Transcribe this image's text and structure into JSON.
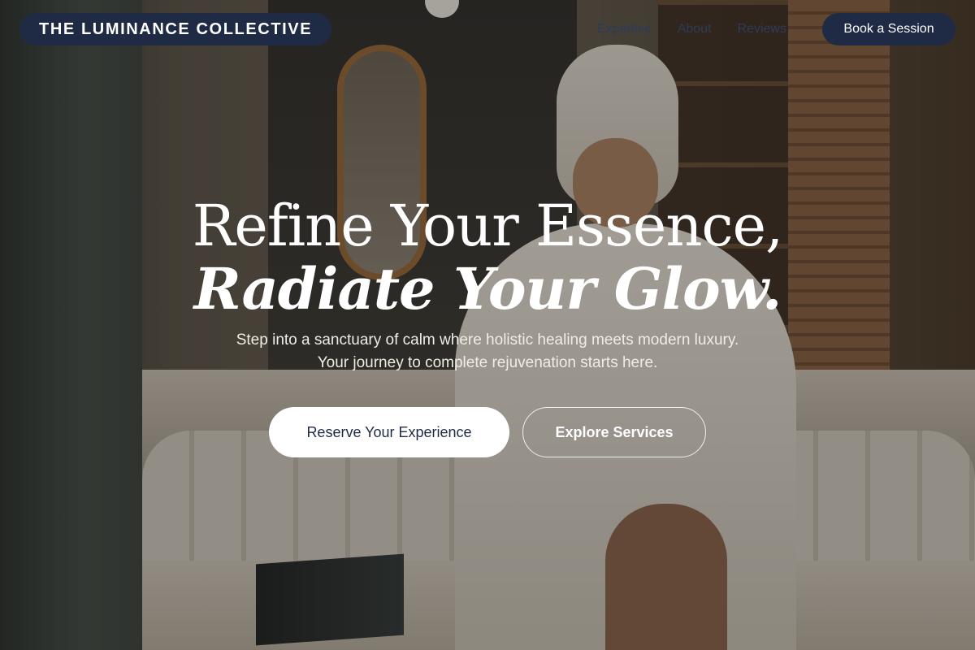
{
  "brand": {
    "name": "THE LUMINANCE COLLECTIVE"
  },
  "nav": {
    "links": [
      "Expertise",
      "About",
      "Reviews"
    ],
    "cta_label": "Book a Session"
  },
  "hero": {
    "headline_line1": "Refine Your Essence,",
    "headline_line2": "Radiate Your Glow.",
    "subtext": "Step into a sanctuary of calm where holistic healing meets modern luxury. Your journey to complete rejuvenation starts here.",
    "primary_button": "Reserve Your Experience",
    "secondary_button": "Explore Services"
  },
  "colors": {
    "brand_navy": "#1f2b45",
    "button_white": "#ffffff",
    "text_light": "#f1ece4"
  },
  "icons": {
    "background_image": "spa-interior-photo"
  }
}
